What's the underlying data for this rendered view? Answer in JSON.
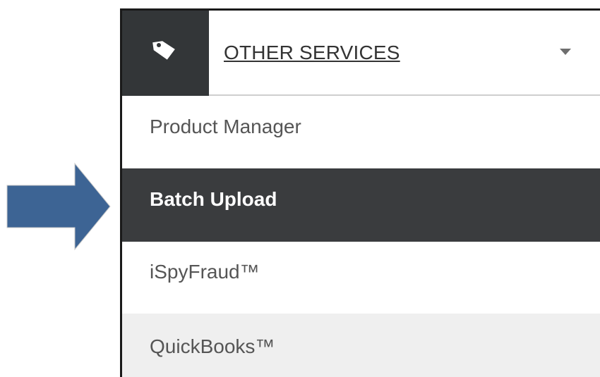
{
  "menu": {
    "header_label": "OTHER SERVICES",
    "header_icon": "tag-icon",
    "dropdown_icon": "caret-down-icon",
    "items": [
      {
        "label": "Product Manager",
        "selected": false
      },
      {
        "label": "Batch Upload",
        "selected": true
      },
      {
        "label": "iSpyFraud™",
        "selected": false
      },
      {
        "label": "QuickBooks™",
        "selected": false
      }
    ]
  },
  "colors": {
    "arrow": "#3d6494",
    "dark_bg": "#3a3c3e",
    "hover_bg": "#efefef"
  }
}
